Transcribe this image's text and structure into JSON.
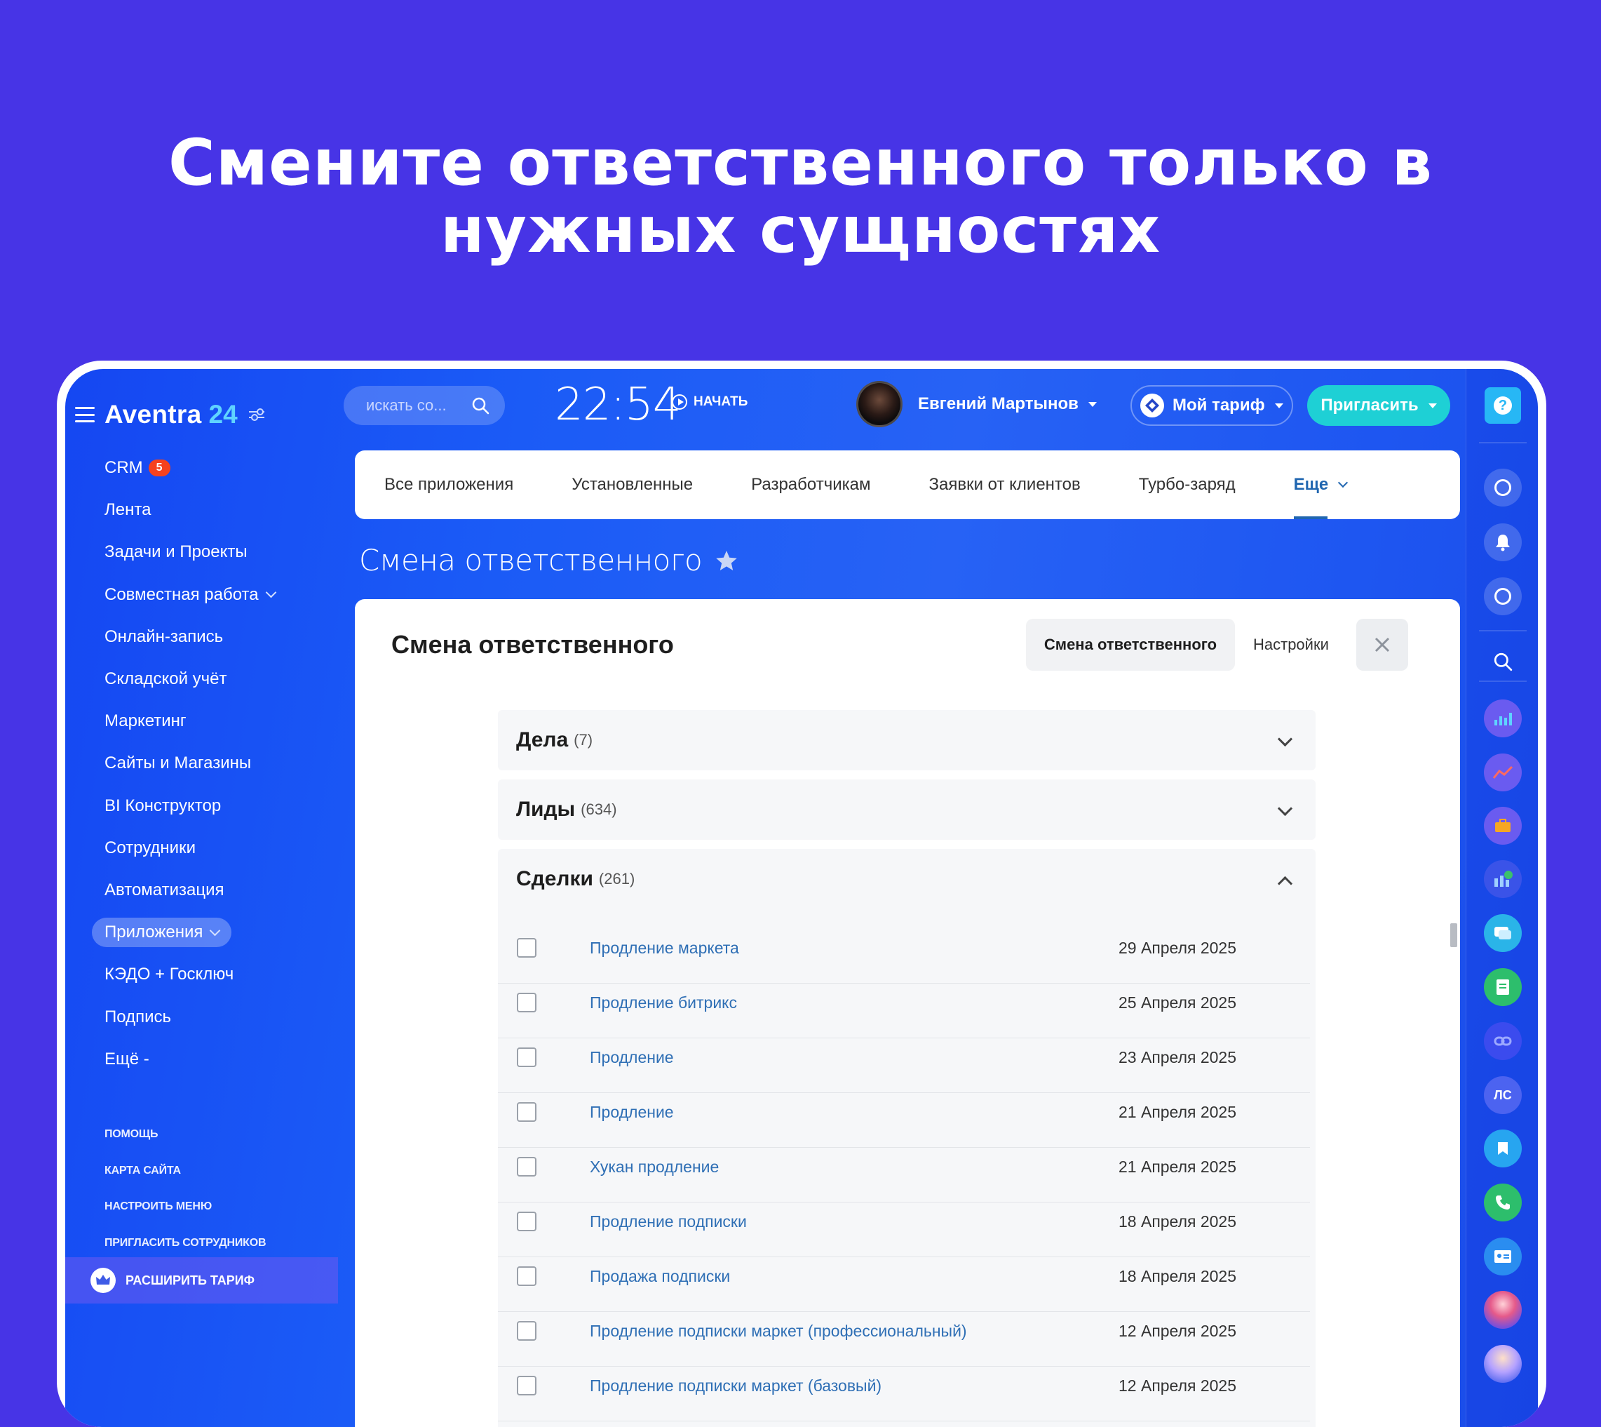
{
  "headline": {
    "line1": "Смените ответственного только в",
    "line2": "нужных сущностях"
  },
  "brand": {
    "name": "Aventra",
    "number": "24"
  },
  "sidebar": {
    "items": [
      {
        "label": "CRM",
        "badge": "5"
      },
      {
        "label": "Лента"
      },
      {
        "label": "Задачи и Проекты"
      },
      {
        "label": "Совместная работа",
        "has_chevron": true
      },
      {
        "label": "Онлайн-запись"
      },
      {
        "label": "Складской учёт"
      },
      {
        "label": "Маркетинг"
      },
      {
        "label": "Сайты и Магазины"
      },
      {
        "label": "BI Конструктор"
      },
      {
        "label": "Сотрудники"
      },
      {
        "label": "Автоматизация"
      },
      {
        "label": "Приложения",
        "active": true,
        "has_chevron": true
      },
      {
        "label": "КЭДО + Госключ"
      },
      {
        "label": "Подпись"
      },
      {
        "label": "Ещё -"
      }
    ],
    "footer": [
      "ПОМОЩЬ",
      "КАРТА САЙТА",
      "НАСТРОИТЬ МЕНЮ",
      "ПРИГЛАСИТЬ СОТРУДНИКОВ"
    ],
    "upgrade_label": "РАСШИРИТЬ ТАРИФ"
  },
  "topbar": {
    "search_placeholder": "искать со...",
    "time": "22:54",
    "start_label": "НАЧАТЬ",
    "user_name": "Евгений Мартынов",
    "tariff_label": "Мой тариф",
    "invite_label": "Пригласить"
  },
  "right_strip": {
    "help": "?",
    "ls_label": "ЛС",
    "icons": [
      "globe-icon",
      "bell-icon",
      "chat-icon",
      "search-icon",
      "analytics-app-icon",
      "chart-app-icon",
      "briefcase-app-icon",
      "report-app-icon",
      "messages-app-icon",
      "document-app-icon",
      "link-app-icon",
      "ls-icon",
      "bookmark-icon",
      "phone-icon",
      "contact-card-icon",
      "assistant-avatar-1",
      "assistant-avatar-2"
    ]
  },
  "tabs": [
    {
      "label": "Все приложения"
    },
    {
      "label": "Установленные"
    },
    {
      "label": "Разработчикам"
    },
    {
      "label": "Заявки от клиентов"
    },
    {
      "label": "Турбо-заряд"
    },
    {
      "label": "Еще",
      "active": true
    }
  ],
  "page": {
    "title": "Смена ответственного",
    "panel_title": "Смена ответственного",
    "segment_active": "Смена ответственного",
    "segment_settings": "Настройки"
  },
  "sections": [
    {
      "title": "Дела",
      "count": "(7)",
      "expanded": false
    },
    {
      "title": "Лиды",
      "count": "(634)",
      "expanded": false
    },
    {
      "title": "Сделки",
      "count": "(261)",
      "expanded": true
    }
  ],
  "deals": [
    {
      "name": "Продление маркета",
      "date": "29 Апреля 2025"
    },
    {
      "name": "Продление битрикс",
      "date": "25 Апреля 2025"
    },
    {
      "name": "Продление",
      "date": "23 Апреля 2025"
    },
    {
      "name": "Продление",
      "date": "21 Апреля 2025"
    },
    {
      "name": "Хукан продление",
      "date": "21 Апреля 2025"
    },
    {
      "name": "Продление подписки",
      "date": "18 Апреля 2025"
    },
    {
      "name": "Продажа подписки",
      "date": "18 Апреля 2025"
    },
    {
      "name": "Продление подписки маркет (профессиональный)",
      "date": "12 Апреля 2025"
    },
    {
      "name": "Продление подписки маркет (базовый)",
      "date": "12 Апреля 2025"
    }
  ],
  "colors": {
    "background": "#4734E6",
    "app_blue": "#1F5AF4",
    "link": "#2F6FB5",
    "invite": "#1ED0D5",
    "badge": "#F5421E"
  }
}
